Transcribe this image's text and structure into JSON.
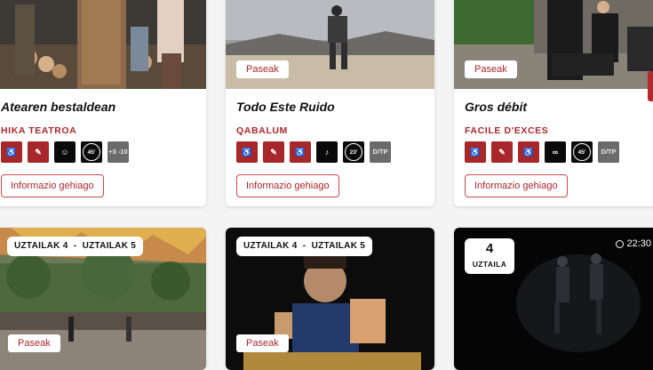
{
  "cards_top": [
    {
      "title": "Atearen bestaldean",
      "company": "HIKA TEATROA",
      "more_label": "Informazio gehiago",
      "icons": [
        {
          "name": "audio-description-icon",
          "style": "red",
          "text": "♿"
        },
        {
          "name": "hearing-loop-icon",
          "style": "red",
          "text": "✎"
        },
        {
          "name": "theatre-masks-icon",
          "style": "black",
          "text": "☺"
        },
        {
          "name": "duration-icon",
          "style": "black",
          "text": "45'"
        },
        {
          "name": "age-rating-icon",
          "style": "grey",
          "text": "+3 -10"
        }
      ]
    },
    {
      "title": "Todo Este Ruido",
      "company": "QABALUM",
      "tag": "Paseak",
      "more_label": "Informazio gehiago",
      "icons": [
        {
          "name": "audio-description-icon",
          "style": "red",
          "text": "♿"
        },
        {
          "name": "hearing-loop-icon",
          "style": "red",
          "text": "✎"
        },
        {
          "name": "wheelchair-icon",
          "style": "red",
          "text": "♿"
        },
        {
          "name": "dance-icon",
          "style": "black",
          "text": "♪"
        },
        {
          "name": "duration-icon",
          "style": "black",
          "text": "23'"
        },
        {
          "name": "all-public-icon",
          "style": "grey",
          "text": "D/TP"
        }
      ]
    },
    {
      "title": "Gros débit",
      "company": "FACILE D'EXCES",
      "tag": "Paseak",
      "more_label": "Informazio gehiago",
      "icons": [
        {
          "name": "audio-description-icon",
          "style": "red",
          "text": "♿"
        },
        {
          "name": "hearing-loop-icon",
          "style": "red",
          "text": "✎"
        },
        {
          "name": "wheelchair-icon",
          "style": "red",
          "text": "♿"
        },
        {
          "name": "circus-icon",
          "style": "black",
          "text": "∞"
        },
        {
          "name": "duration-icon",
          "style": "black",
          "text": "45'"
        },
        {
          "name": "all-public-icon",
          "style": "grey",
          "text": "D/TP"
        }
      ]
    }
  ],
  "cards_bottom": [
    {
      "date_from": "UZTAILAK 4",
      "sep": "-",
      "date_to": "UZTAILAK 5",
      "tag": "Paseak"
    },
    {
      "date_from": "UZTAILAK 4",
      "sep": "-",
      "date_to": "UZTAILAK 5",
      "tag": "Paseak"
    },
    {
      "day": "4",
      "month": "UZTAILA",
      "time": "22:30"
    }
  ],
  "colors": {
    "accent": "#a8272b",
    "background": "#f4f4f4"
  }
}
